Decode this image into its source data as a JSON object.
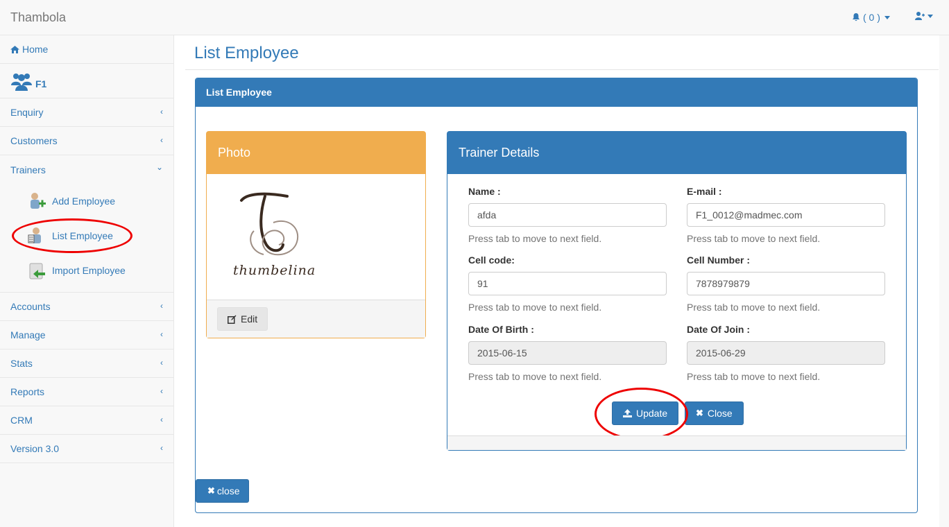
{
  "app": {
    "brand": "Thambola"
  },
  "navbar": {
    "notifications": "( 0 )",
    "bell_icon": "bell-icon",
    "user_icon": "user-icon"
  },
  "sidebar": {
    "home": "Home",
    "f1": "F1",
    "items": [
      {
        "label": "Enquiry"
      },
      {
        "label": "Customers"
      },
      {
        "label": "Trainers"
      }
    ],
    "trainers_sub": [
      {
        "label": "Add Employee"
      },
      {
        "label": "List Employee"
      },
      {
        "label": "Import Employee"
      }
    ],
    "items_after": [
      {
        "label": "Accounts"
      },
      {
        "label": "Manage"
      },
      {
        "label": "Stats"
      },
      {
        "label": "Reports"
      },
      {
        "label": "CRM"
      },
      {
        "label": "Version 3.0"
      }
    ]
  },
  "main": {
    "page_title": "List Employee",
    "panel_title": "List Employee",
    "photo": {
      "title": "Photo",
      "logo_text": "thumbelina",
      "edit_label": "Edit"
    },
    "trainer": {
      "title": "Trainer Details",
      "fields": {
        "name": {
          "label": "Name :",
          "value": "afda",
          "help": "Press tab to move to next field."
        },
        "email": {
          "label": "E-mail :",
          "value": "F1_0012@madmec.com",
          "help": "Press tab to move to next field."
        },
        "cell_code": {
          "label": "Cell code:",
          "value": "91",
          "help": "Press tab to move to next field."
        },
        "cell_number": {
          "label": "Cell Number :",
          "value": "7878979879",
          "help": "Press tab to move to next field."
        },
        "dob": {
          "label": "Date Of Birth :",
          "value": "2015-06-15",
          "help": "Press tab to move to next field."
        },
        "doj": {
          "label": "Date Of Join :",
          "value": "2015-06-29",
          "help": "Press tab to move to next field."
        }
      },
      "update_label": "Update",
      "close_label": "Close"
    },
    "close_label": "close"
  },
  "colors": {
    "primary": "#337ab7",
    "warning": "#f0ad4e",
    "annotation": "#ee0000"
  }
}
